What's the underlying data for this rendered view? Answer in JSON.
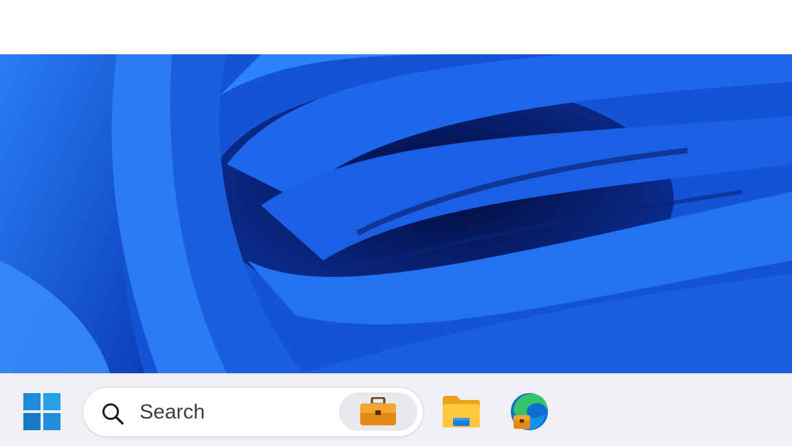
{
  "taskbar": {
    "start": {
      "icon": "windows-logo-icon"
    },
    "search": {
      "label": "Search",
      "icon": "search-icon",
      "highlight_icon": "briefcase-icon"
    },
    "apps": [
      {
        "name": "file-explorer",
        "icon": "folder-icon"
      },
      {
        "name": "microsoft-edge",
        "icon": "edge-icon"
      }
    ]
  },
  "colors": {
    "accent": "#1e6ee8",
    "taskbar": "#eef0f3",
    "wallpaper": "#0a2a8a"
  }
}
